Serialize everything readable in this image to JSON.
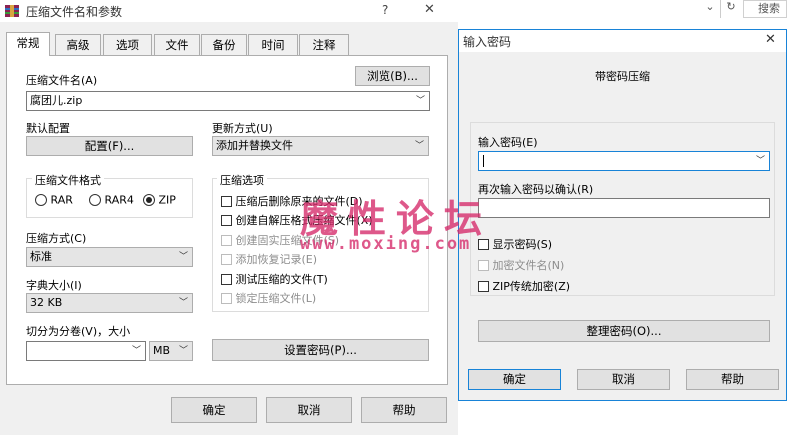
{
  "main_dialog": {
    "title": "压缩文件名和参数",
    "help_glyph": "?",
    "close_glyph": "✕",
    "tabs": [
      {
        "label": "常规"
      },
      {
        "label": "高级"
      },
      {
        "label": "选项"
      },
      {
        "label": "文件"
      },
      {
        "label": "备份"
      },
      {
        "label": "时间"
      },
      {
        "label": "注释"
      }
    ],
    "archive_name_label": "压缩文件名(A)",
    "browse_button": "浏览(B)...",
    "archive_name_value": "腐团儿.zip",
    "default_profile_label": "默认配置",
    "profiles_button": "配置(F)...",
    "update_mode_label": "更新方式(U)",
    "update_mode_value": "添加并替换文件",
    "format_group_title": "压缩文件格式",
    "formats": [
      {
        "label": "RAR",
        "selected": false
      },
      {
        "label": "RAR4",
        "selected": false
      },
      {
        "label": "ZIP",
        "selected": true
      }
    ],
    "options_group_title": "压缩选项",
    "options": [
      {
        "label": "压缩后删除原来的文件(D)",
        "checked": false,
        "enabled": true
      },
      {
        "label": "创建自解压格式压缩文件(X)",
        "checked": false,
        "enabled": true
      },
      {
        "label": "创建固实压缩文件(S)",
        "checked": false,
        "enabled": false
      },
      {
        "label": "添加恢复记录(E)",
        "checked": false,
        "enabled": false
      },
      {
        "label": "测试压缩的文件(T)",
        "checked": false,
        "enabled": true
      },
      {
        "label": "锁定压缩文件(L)",
        "checked": false,
        "enabled": false
      }
    ],
    "method_label": "压缩方式(C)",
    "method_value": "标准",
    "dict_label": "字典大小(I)",
    "dict_value": "32 KB",
    "split_label": "切分为分卷(V)，大小",
    "split_value": "",
    "split_unit": "MB",
    "set_password_button": "设置密码(P)...",
    "ok_button": "确定",
    "cancel_button": "取消",
    "help_button": "帮助"
  },
  "background_window": {
    "search_placeholder": "搜索",
    "dropdown_glyph": "⌄",
    "refresh_glyph": "↻"
  },
  "password_dialog": {
    "title": "输入密码",
    "close_glyph": "✕",
    "heading": "带密码压缩",
    "enter_label": "输入密码(E)",
    "enter_value": "",
    "reenter_label": "再次输入密码以确认(R)",
    "reenter_value": "",
    "checkboxes": [
      {
        "label": "显示密码(S)",
        "checked": false,
        "enabled": true
      },
      {
        "label": "加密文件名(N)",
        "checked": false,
        "enabled": false
      },
      {
        "label": "ZIP传统加密(Z)",
        "checked": false,
        "enabled": true
      }
    ],
    "organize_button": "整理密码(O)...",
    "ok_button": "确定",
    "cancel_button": "取消",
    "help_button": "帮助"
  },
  "watermark": {
    "text": "魔性论坛",
    "url": "www.moxing.com"
  },
  "colors": {
    "dialog_bg": "#f0f0f0",
    "accent_border": "#1883d7",
    "watermark": "#d62a6a"
  }
}
